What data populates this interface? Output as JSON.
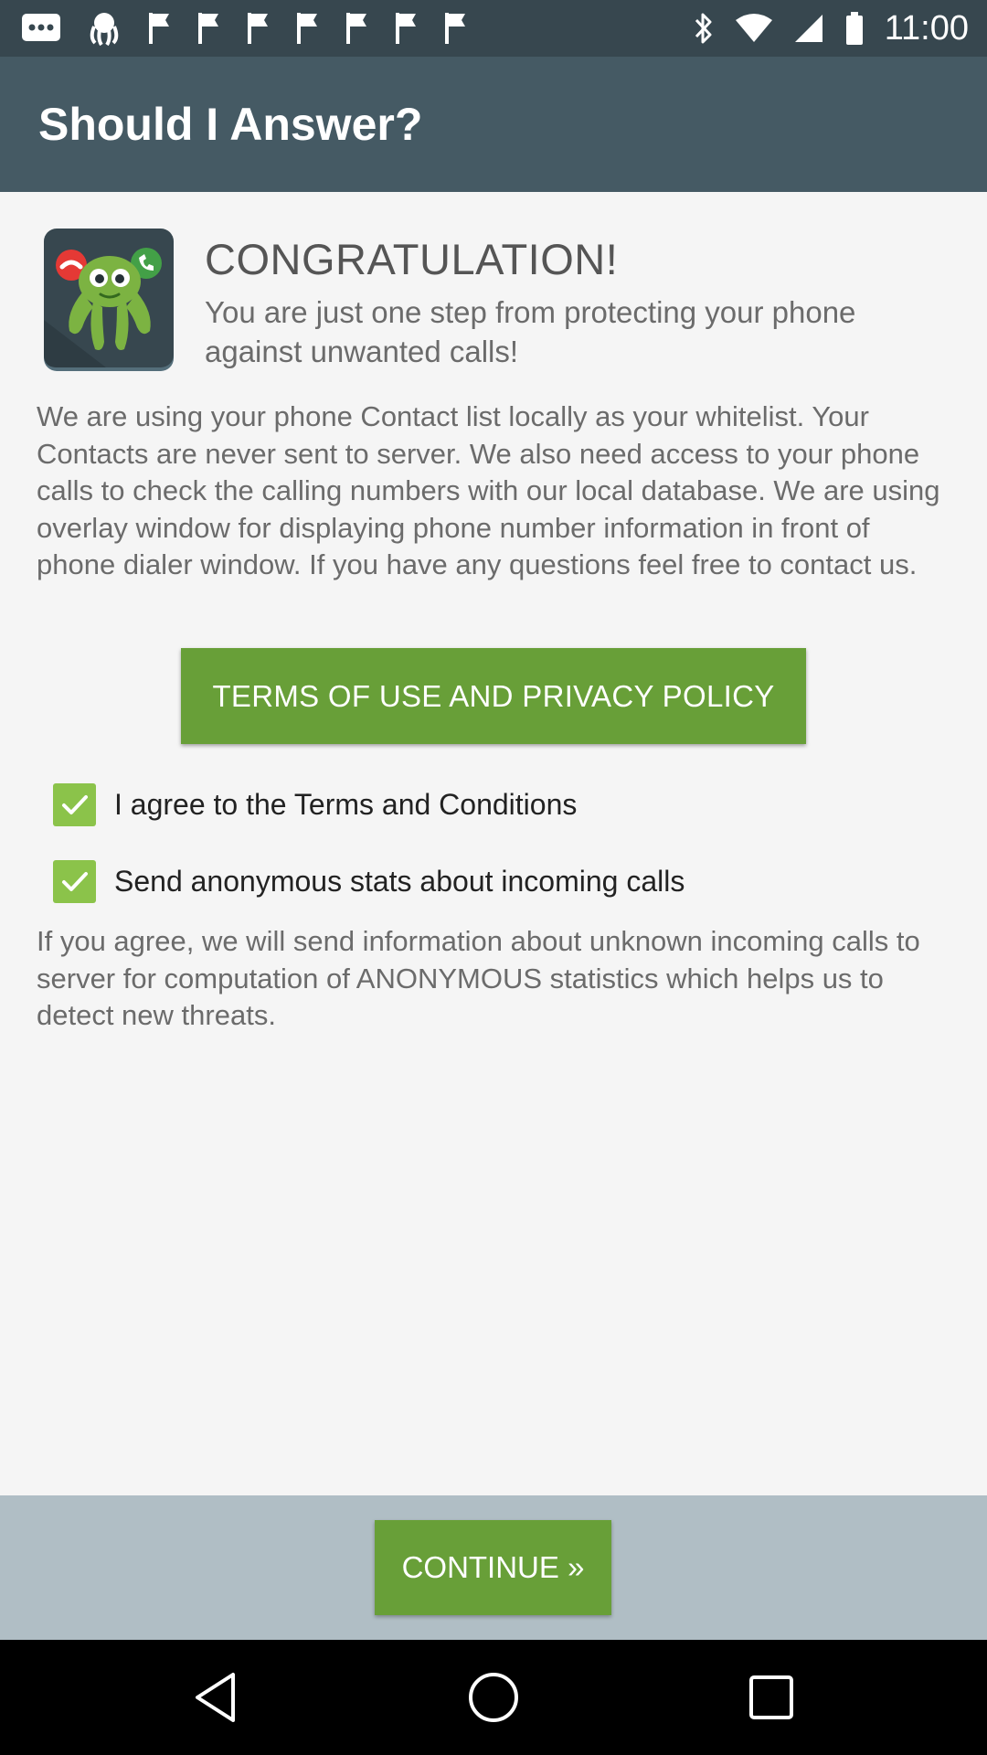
{
  "status_bar": {
    "time": "11:00",
    "icons": [
      "message-icon",
      "octopus-app-icon",
      "flag-icon",
      "flag-icon",
      "flag-icon",
      "flag-icon",
      "flag-icon",
      "flag-icon",
      "flag-icon",
      "bluetooth-icon",
      "wifi-icon",
      "signal-icon",
      "battery-icon"
    ]
  },
  "app_bar": {
    "title": "Should I Answer?"
  },
  "header": {
    "title": "CONGRATULATION!",
    "subtitle": "You are just one step from protecting your phone against unwanted calls!"
  },
  "intro": {
    "text": "We are using your phone Contact list locally as your whitelist. Your Contacts are never sent to server. We also need access to your phone calls to check the calling numbers with our local database. We are using overlay window for displaying phone number information in front of phone dialer window. If you have any questions feel free to contact us."
  },
  "terms_button": {
    "label": "TERMS OF USE AND PRIVACY POLICY"
  },
  "checkboxes": [
    {
      "label": "I agree to the Terms and Conditions",
      "checked": true
    },
    {
      "label": "Send anonymous stats about incoming calls",
      "checked": true
    }
  ],
  "stats_info": {
    "text": "If you agree, we will send information about unknown incoming calls to server for computation of ANONYMOUS statistics which helps us to detect new threats."
  },
  "footer": {
    "continue_label": "CONTINUE »"
  },
  "colors": {
    "status_bar": "#37474f",
    "app_bar": "#455a64",
    "accent_green": "#689f38",
    "checkbox_green": "#8bc34a",
    "footer_bg": "#b0bec5"
  }
}
